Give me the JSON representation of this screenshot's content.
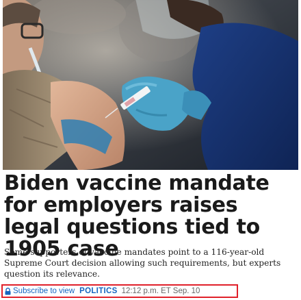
{
  "article": {
    "image_alt": "Healthcare worker in blue gloves administering a vaccine injection into a person's upper arm",
    "headline": "Biden vaccine mandate for employers raises legal questions tied to 1905 case",
    "summary": "Some supporters of vaccine mandates point to a 116-year-old Supreme Court decision allowing such requirements, but experts question its relevance.",
    "subscribe_label": "Subscribe to view",
    "section_label": "POLITICS",
    "timestamp": "12:12 p.m. ET Sep. 10"
  },
  "colors": {
    "link": "#1565c0",
    "highlight_border": "#e0202a",
    "glove": "#4aa3c8"
  },
  "icons": {
    "subscribe": "lock-icon"
  }
}
